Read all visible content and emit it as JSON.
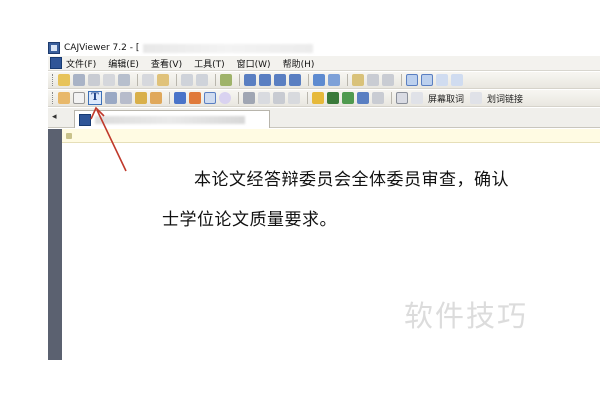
{
  "window": {
    "title": "CAJViewer 7.2 - ["
  },
  "menu": {
    "items": [
      "文件(F)",
      "编辑(E)",
      "查看(V)",
      "工具(T)",
      "窗口(W)",
      "帮助(H)"
    ]
  },
  "toolbar2": {
    "screen_word_label": "屏幕取词",
    "hyperlink_label": "划词链接"
  },
  "document": {
    "line1": "本论文经答辩委员会全体委员审查，确认",
    "line2": "士学位论文质量要求。"
  },
  "watermark": {
    "text": "软件技巧"
  },
  "colors": {
    "left_rail": "#5b6170",
    "info_bar": "#fffbe3",
    "annotation_arrow": "#c0392b",
    "text_tool_highlight": "#3b6fb6"
  }
}
